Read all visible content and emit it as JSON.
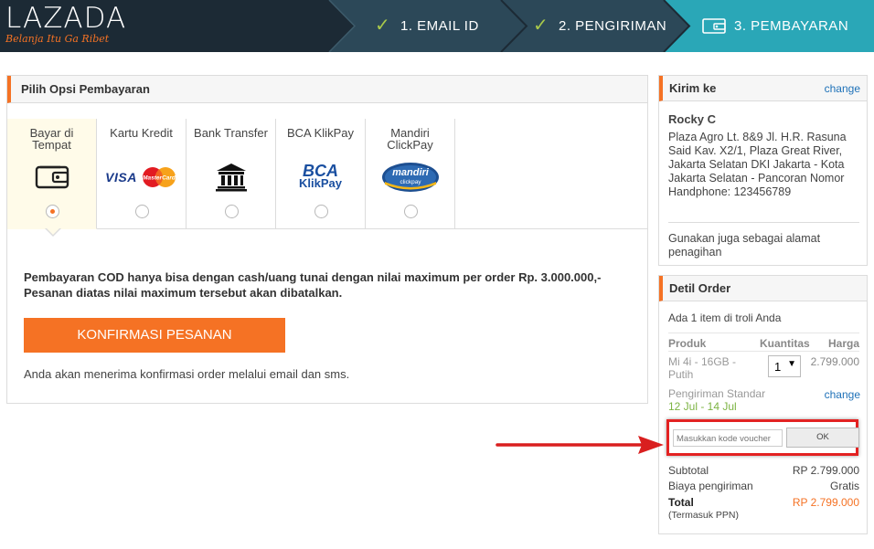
{
  "header": {
    "logo_text": "LAZADA",
    "tagline": "Belanja Itu Ga Ribet",
    "steps": [
      {
        "label": "1. EMAIL ID",
        "state": "done"
      },
      {
        "label": "2. PENGIRIMAN",
        "state": "done"
      },
      {
        "label": "3. PEMBAYARAN",
        "state": "active"
      }
    ]
  },
  "payment": {
    "title": "Pilih Opsi Pembayaran",
    "options": [
      {
        "label": "Bayar di Tempat",
        "icon": "wallet-icon",
        "selected": true
      },
      {
        "label": "Kartu Kredit",
        "icon": "visa-mastercard-icon",
        "selected": false
      },
      {
        "label": "Bank Transfer",
        "icon": "bank-icon",
        "selected": false
      },
      {
        "label": "BCA KlikPay",
        "icon": "bca-klikpay-icon",
        "selected": false
      },
      {
        "label": "Mandiri ClickPay",
        "icon": "mandiri-clickpay-icon",
        "selected": false
      }
    ],
    "logos": {
      "visa": "VISA",
      "mastercard": "MasterCard",
      "bca": "BCA",
      "klikpay": "KlikPay",
      "mandiri": "mandiri",
      "clickpay": "clickpay"
    },
    "cod_note": "Pembayaran COD hanya bisa dengan cash/uang tunai dengan nilai maximum per order Rp. 3.000.000,- Pesanan diatas nilai maximum tersebut akan dibatalkan.",
    "confirm_button": "KONFIRMASI PESANAN",
    "confirm_note": "Anda akan menerima konfirmasi order melalui email dan sms."
  },
  "shipping": {
    "title": "Kirim ke",
    "change": "change",
    "name": "Rocky C",
    "address": "Plaza Agro Lt. 8&9 Jl. H.R. Rasuna Said Kav. X2/1, Plaza Great River, Jakarta Selatan DKI Jakarta - Kota Jakarta Selatan - Pancoran Nomor Handphone: 123456789",
    "billing_note": "Gunakan juga sebagai alamat penagihan"
  },
  "order": {
    "title": "Detil Order",
    "count_text": "Ada 1 item di troli Anda",
    "col_product": "Produk",
    "col_qty": "Kuantitas",
    "col_price": "Harga",
    "product_name": "Mi 4i - 16GB - Putih",
    "quantity": "1",
    "price": "2.799.000",
    "shipping_type": "Pengiriman Standar",
    "shipping_dates": "12 Jul - 14 Jul",
    "shipping_change": "change",
    "voucher_placeholder": "Masukkan kode voucher",
    "voucher_button": "OK",
    "subtotal_label": "Subtotal",
    "subtotal_value": "RP 2.799.000",
    "shipping_fee_label": "Biaya pengiriman",
    "shipping_fee_value": "Gratis",
    "total_label": "Total",
    "total_value": "RP 2.799.000",
    "tax_note": "(Termasuk PPN)"
  },
  "colors": {
    "brand_orange": "#f57224",
    "header_dark": "#1c2a35",
    "step_done": "#2c4858",
    "step_active": "#2aa7b7",
    "check_green": "#a9c94a",
    "link_blue": "#1e71b8",
    "annotation_red": "#e32222"
  }
}
